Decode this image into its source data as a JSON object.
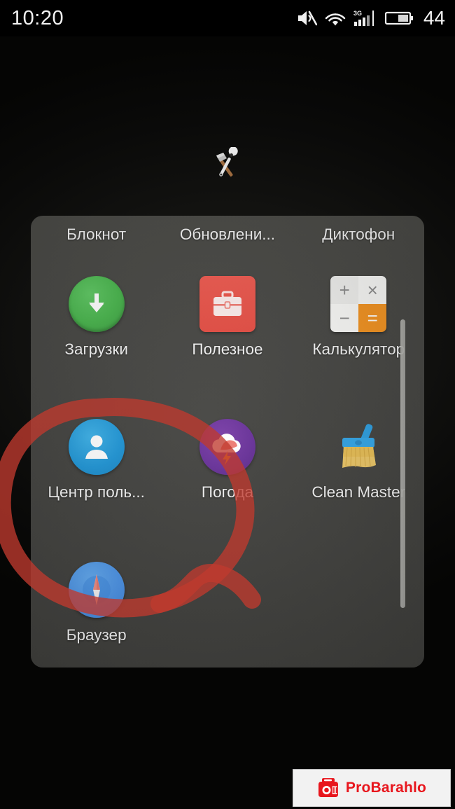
{
  "status_bar": {
    "time": "10:20",
    "battery_level": "44",
    "icons": [
      "mute-icon",
      "wifi-icon",
      "signal-3g-icon",
      "battery-icon"
    ],
    "network_type": "3G"
  },
  "folder": {
    "header_icon": "tools-icon",
    "rows": [
      {
        "labels_only": true,
        "apps": [
          {
            "label": "Блокнот",
            "icon": "notepad-icon"
          },
          {
            "label": "Обновлени...",
            "icon": "updater-icon"
          },
          {
            "label": "Диктофон",
            "icon": "voice-recorder-icon"
          }
        ]
      },
      {
        "labels_only": false,
        "apps": [
          {
            "label": "Загрузки",
            "icon": "downloads-icon",
            "color": "#49b44d"
          },
          {
            "label": "Полезное",
            "icon": "useful-briefcase-icon",
            "color": "#e44e44"
          },
          {
            "label": "Калькулятор",
            "icon": "calculator-icon",
            "color": "#f29322"
          }
        ]
      },
      {
        "labels_only": false,
        "apps": [
          {
            "label": "Центр поль...",
            "icon": "user-center-icon",
            "color": "#2196d6"
          },
          {
            "label": "Погода",
            "icon": "weather-icon",
            "color": "#69329a"
          },
          {
            "label": "Clean Master",
            "icon": "clean-master-broom-icon",
            "color": "#f2ce6a"
          }
        ]
      },
      {
        "labels_only": false,
        "apps": [
          {
            "label": "Браузер",
            "icon": "browser-compass-icon",
            "color": "#4c92e4"
          }
        ]
      }
    ],
    "scrollbar": {
      "name": "folder-scrollbar"
    },
    "calculator_keys": {
      "plus": "+",
      "times": "×",
      "minus": "−",
      "equals": "="
    }
  },
  "annotation": {
    "name": "red-circle-annotation",
    "color": "#c0392b",
    "shape": "hand-drawn-oval"
  },
  "watermark": {
    "text": "ProBarahlo",
    "icon": "camera-icon",
    "color": "#e8161d"
  }
}
